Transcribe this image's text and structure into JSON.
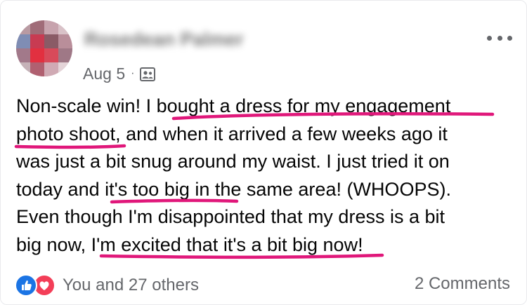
{
  "post": {
    "author_name": "Rosedean Palmer",
    "timestamp": "Aug 5",
    "separator": "·",
    "audience_icon": "friends-audience-icon",
    "more_icon": "more-options-icon",
    "text_segments": [
      {
        "text": "Non-scale win! I "
      },
      {
        "text": "bought a dress for my engagement"
      },
      {
        "text": "photo shoot"
      },
      {
        "text": ", and when it arrived a few weeks ago it"
      },
      {
        "text": "was just a bit snug around my waist. I just tried it on"
      },
      {
        "text": "today and "
      },
      {
        "text": "it's too big in"
      },
      {
        "text": " the same area! (WHOOPS)."
      },
      {
        "text": "Even though I'm disappointed that my dress is a bit"
      },
      {
        "text": "big now, "
      },
      {
        "text": "I'm excited that it's a bit big now"
      },
      {
        "text": "!"
      }
    ]
  },
  "reactions": {
    "icons": [
      "like-icon",
      "love-icon"
    ],
    "label": "You and 27 others"
  },
  "comments": {
    "label": "2 Comments"
  },
  "colors": {
    "text": "#050505",
    "secondary_text": "#65676b",
    "underline_marker": "#e0177a",
    "like_blue": "#1b74e4",
    "love_red": "#f33e58"
  }
}
